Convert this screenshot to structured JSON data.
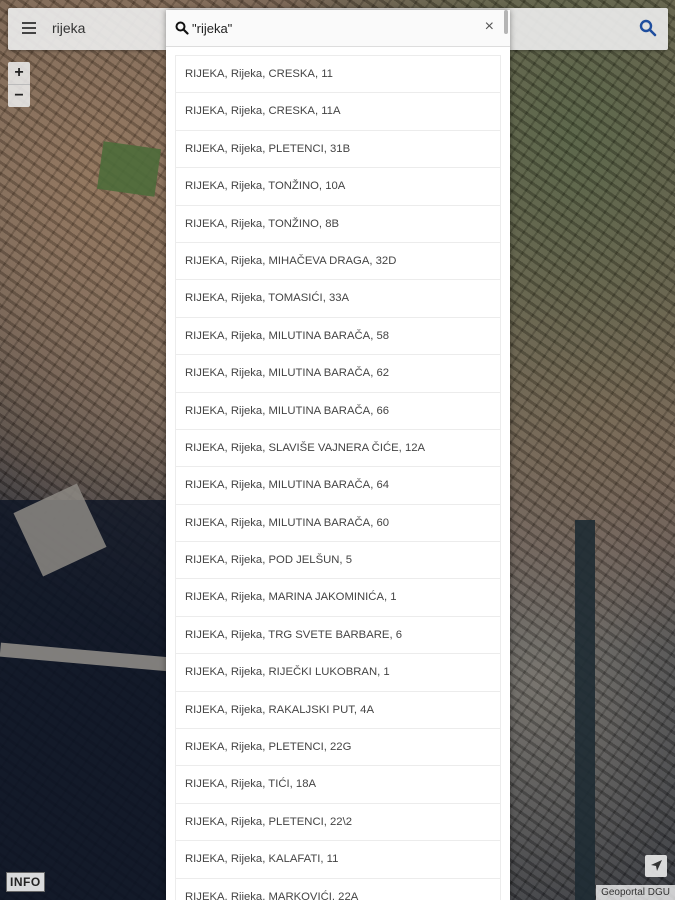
{
  "app": {
    "title": "rijeka"
  },
  "map": {
    "zoom_in_label": "+",
    "zoom_out_label": "−",
    "info_label": "INFO",
    "attribution": "Geoportal DGU"
  },
  "search": {
    "query": "\"rijeka\"",
    "close_label": "×",
    "results": [
      "RIJEKA, Rijeka, CRESKA, 11",
      "RIJEKA, Rijeka, CRESKA, 11A",
      "RIJEKA, Rijeka, PLETENCI, 31B",
      "RIJEKA, Rijeka, TONŽINO, 10A",
      "RIJEKA, Rijeka, TONŽINO, 8B",
      "RIJEKA, Rijeka, MIHAČEVA DRAGA, 32D",
      "RIJEKA, Rijeka, TOMASIĆI, 33A",
      "RIJEKA, Rijeka, MILUTINA BARAČA, 58",
      "RIJEKA, Rijeka, MILUTINA BARAČA, 62",
      "RIJEKA, Rijeka, MILUTINA BARAČA, 66",
      "RIJEKA, Rijeka, SLAVIŠE VAJNERA ČIĆE, 12A",
      "RIJEKA, Rijeka, MILUTINA BARAČA, 64",
      "RIJEKA, Rijeka, MILUTINA BARAČA, 60",
      "RIJEKA, Rijeka, POD JELŠUN, 5",
      "RIJEKA, Rijeka, MARINA JAKOMINIĆA, 1",
      "RIJEKA, Rijeka, TRG SVETE BARBARE, 6",
      "RIJEKA, Rijeka, RIJEČKI LUKOBRAN, 1",
      "RIJEKA, Rijeka, RAKALJSKI PUT, 4A",
      "RIJEKA, Rijeka, PLETENCI, 22G",
      "RIJEKA, Rijeka, TIĆI, 18A",
      "RIJEKA, Rijeka, PLETENCI, 22\\2",
      "RIJEKA, Rijeka, KALAFATI, 11",
      "RIJEKA, Rijeka, MARKOVIĆI, 22A"
    ]
  },
  "colors": {
    "accent": "#1f4e9e",
    "panel_bg": "#ffffff",
    "text": "#444444"
  }
}
